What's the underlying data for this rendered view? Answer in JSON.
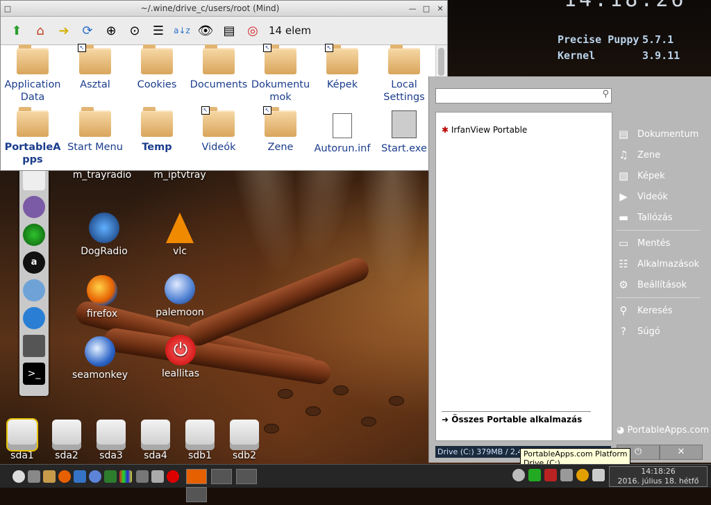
{
  "desktop": {
    "clock_big": "14:18:26",
    "sysinfo": {
      "distro_label": "Precise Puppy",
      "distro_value": "5.7.1",
      "kernel_label": "Kernel",
      "kernel_value": "3.9.11"
    },
    "icons": [
      "m_trayradio",
      "m_iptvtray",
      "DogRadio",
      "vlc",
      "firefox",
      "palemoon",
      "seamonkey",
      "leallitas"
    ],
    "drives": [
      "sda1",
      "sda2",
      "sda3",
      "sda4",
      "sdb1",
      "sdb2"
    ]
  },
  "filemanager": {
    "title": "~/.wine/drive_c/users/root (Mind)",
    "toolbar_count": "14 elem",
    "window_buttons": [
      "□",
      "—",
      "□",
      "✕"
    ],
    "files": [
      {
        "line1": "Application",
        "line2": "Data"
      },
      {
        "line1": "Asztal",
        "line2": ""
      },
      {
        "line1": "Cookies",
        "line2": ""
      },
      {
        "line1": "Documents",
        "line2": ""
      },
      {
        "line1": "Dokumentu",
        "line2": "mok"
      },
      {
        "line1": "Képek",
        "line2": ""
      },
      {
        "line1": "Local",
        "line2": "Settings"
      },
      {
        "line1": "PortableA",
        "line2": "pps"
      },
      {
        "line1": "Start Menu",
        "line2": ""
      },
      {
        "line1": "Temp",
        "line2": ""
      },
      {
        "line1": "Videók",
        "line2": ""
      },
      {
        "line1": "Zene",
        "line2": ""
      },
      {
        "line1": "Autorun.inf",
        "line2": ""
      },
      {
        "line1": "Start.exe",
        "line2": ""
      }
    ]
  },
  "portableapps": {
    "app_item": "IrfanView Portable",
    "all_apps": "Összes Portable alkalmazás",
    "menu": [
      "Dokumentum",
      "Zene",
      "Képek",
      "Videók",
      "Tallózás",
      "Mentés",
      "Alkalmazások",
      "Beállítások",
      "Keresés",
      "Súgó"
    ],
    "brand": "PortableApps.com",
    "drive_status": "Drive (C:) 379MB / 2,4GB",
    "power_symbol": "⏻",
    "close_symbol": "✕",
    "tooltip_line1": "PortableApps.com Platform",
    "tooltip_line2": "Drive (C:)"
  },
  "taskbar": {
    "time": "14:18:26",
    "date": "2016. július 18. hétfő"
  }
}
